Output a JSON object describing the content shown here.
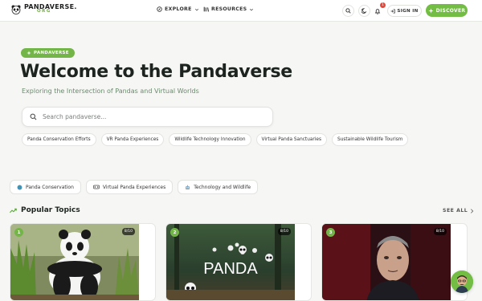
{
  "header": {
    "logo_text": "PANDAVERSE.",
    "logo_sub": "ORG",
    "nav": [
      {
        "label": "EXPLORE",
        "icon": "compass-icon"
      },
      {
        "label": "RESOURCES",
        "icon": "library-icon"
      }
    ],
    "notification_count": "1",
    "signin_label": "SIGN IN",
    "discover_label": "DISCOVER"
  },
  "hero": {
    "badge": "PANDAVERSE",
    "title": "Welcome to the Pandaverse",
    "subtitle": "Exploring the Intersection of Pandas and Virtual Worlds",
    "search_placeholder": "Search pandaverse...",
    "chips": [
      "Panda Conservation Efforts",
      "VR Panda Experiences",
      "Wildlife Technology Innovation",
      "Virtual Panda Sanctuaries",
      "Sustainable Wildlife Tourism"
    ]
  },
  "categories": [
    {
      "label": "Panda Conservation",
      "icon": "globe-icon"
    },
    {
      "label": "Virtual Panda Experiences",
      "icon": "vr-goggles-icon"
    },
    {
      "label": "Technology and Wildlife",
      "icon": "robot-icon"
    }
  ],
  "popular": {
    "title": "Popular Topics",
    "see_all": "SEE ALL",
    "cards": [
      {
        "rank": "1",
        "score": "8/10",
        "caption": ""
      },
      {
        "rank": "2",
        "score": "8/10",
        "caption": "PANDA"
      },
      {
        "rank": "3",
        "score": "8/10",
        "caption": ""
      }
    ]
  },
  "colors": {
    "accent": "#73bd45",
    "badge_red": "#e14a3b"
  }
}
